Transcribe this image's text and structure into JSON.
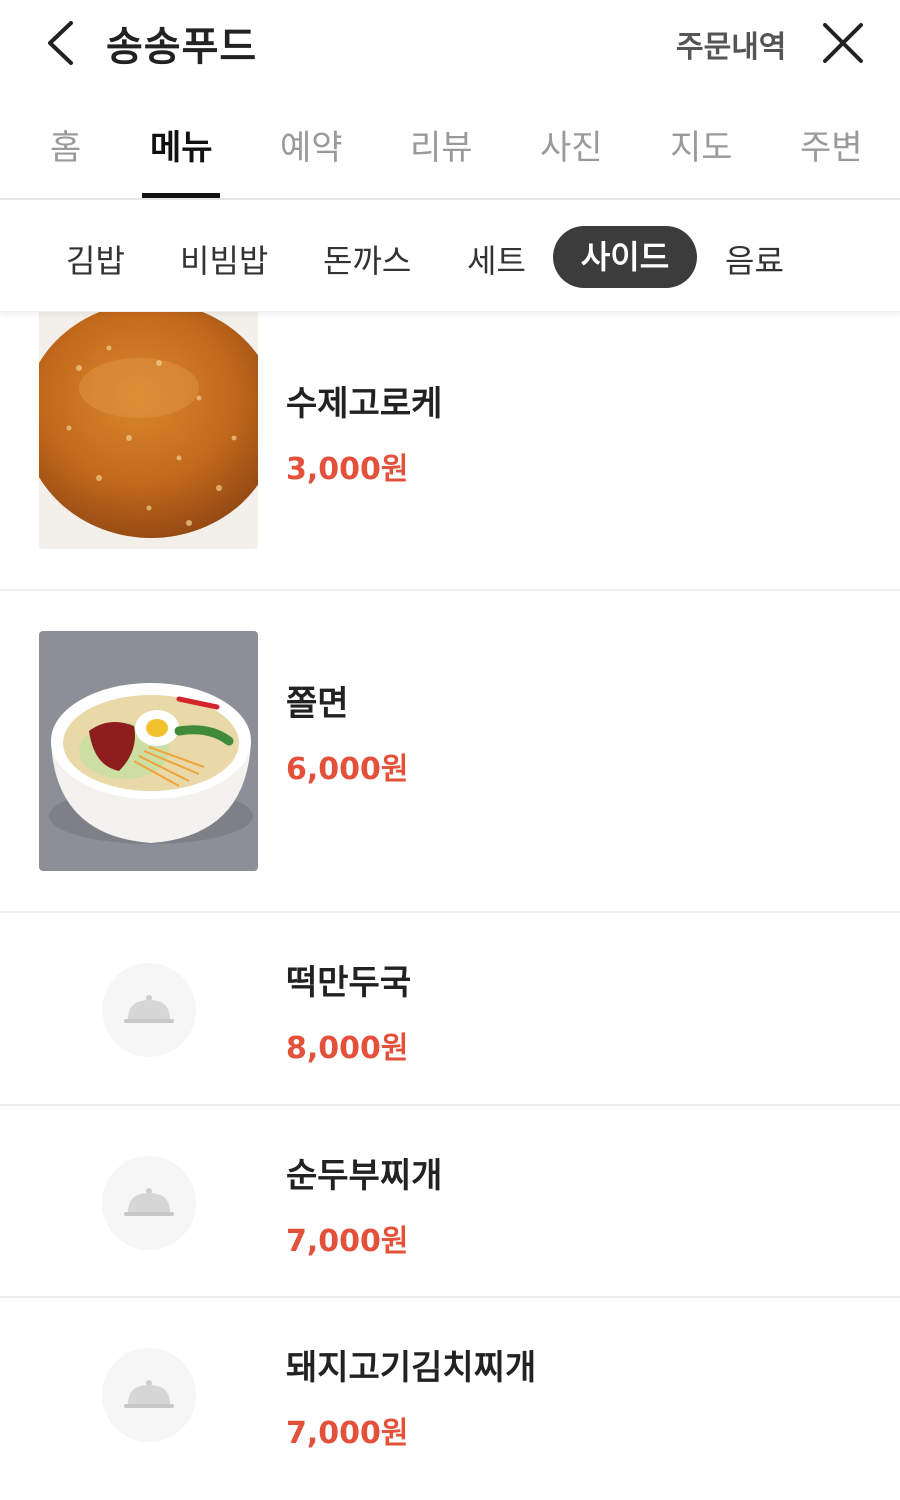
{
  "header": {
    "title": "송송푸드",
    "order_history": "주문내역",
    "back_icon": "chevron-left-icon",
    "close_icon": "close-icon"
  },
  "tabs": [
    {
      "label": "홈",
      "active": false
    },
    {
      "label": "메뉴",
      "active": true
    },
    {
      "label": "예약",
      "active": false
    },
    {
      "label": "리뷰",
      "active": false
    },
    {
      "label": "사진",
      "active": false
    },
    {
      "label": "지도",
      "active": false
    },
    {
      "label": "주변",
      "active": false
    }
  ],
  "categories": [
    {
      "label": "김밥",
      "active": false
    },
    {
      "label": "비빔밥",
      "active": false
    },
    {
      "label": "돈까스",
      "active": false
    },
    {
      "label": "세트",
      "active": false
    },
    {
      "label": "사이드",
      "active": true
    },
    {
      "label": "음료",
      "active": false
    }
  ],
  "menu_items": [
    {
      "name": "수제고로케",
      "price": "3,000원",
      "image": "croquette-photo"
    },
    {
      "name": "쫄면",
      "price": "6,000원",
      "image": "jjolmyeon-photo"
    },
    {
      "name": "떡만두국",
      "price": "8,000원",
      "image": "cloche-placeholder-icon"
    },
    {
      "name": "순두부찌개",
      "price": "7,000원",
      "image": "cloche-placeholder-icon"
    },
    {
      "name": "돼지고기김치찌개",
      "price": "7,000원",
      "image": "cloche-placeholder-icon"
    }
  ],
  "colors": {
    "price": "#e4513b",
    "active_category_bg": "#3c3c3c",
    "tab_inactive": "#9a9a9a"
  }
}
